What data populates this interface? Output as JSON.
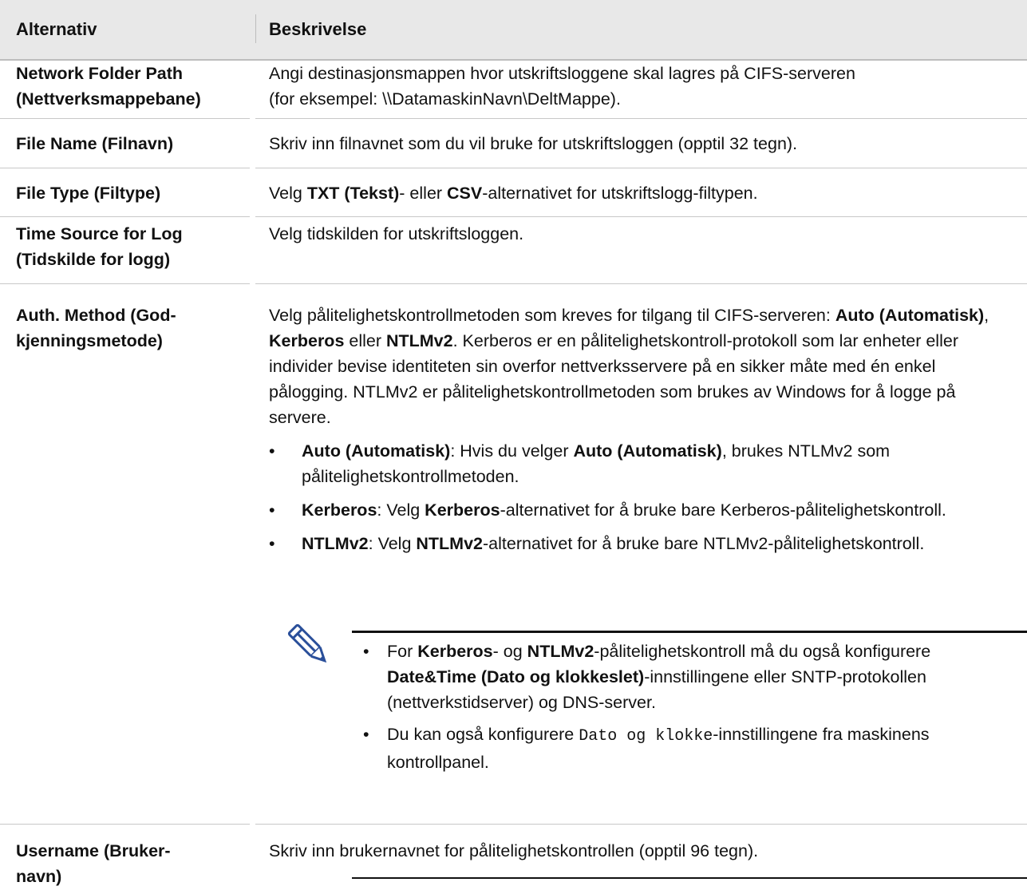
{
  "header": {
    "col1": "Alternativ",
    "col2": "Beskrivelse"
  },
  "rows": [
    {
      "option": [
        "Network Folder Path",
        "(Nettverksmappebane)"
      ],
      "desc": [
        "Angi destinasjonsmappen hvor utskriftsloggene skal lagres på CIFS-serveren",
        "(for eksempel: \\\\DatamaskinNavn\\DeltMappe)."
      ]
    },
    {
      "option": [
        "File Name (Filnavn)"
      ],
      "desc": [
        "Skriv inn filnavnet som du vil bruke for utskriftsloggen (opptil 32 tegn)."
      ]
    },
    {
      "option": [
        "File Type (Filtype)"
      ],
      "desc_parts": [
        "Velg ",
        "TXT (Tekst)",
        "- eller ",
        "CSV",
        "-alternativet for utskriftslogg-filtypen."
      ]
    },
    {
      "option": [
        "Time Source for Log",
        "(Tidskilde for logg)"
      ],
      "desc": [
        "Velg tidskilden for utskriftsloggen."
      ]
    },
    {
      "option": [
        "Auth. Method (God-",
        "kjenningsmetode)"
      ],
      "desc_parts": [
        "Velg pålitelighetskontrollmetoden som kreves for tilgang til CIFS-serveren: ",
        "Auto (Automatisk)",
        ", ",
        "Kerberos",
        " eller ",
        "NTLMv2",
        ". Kerberos er en pålitelighetskontroll-protokoll som lar enheter eller individer bevise identiteten sin overfor nettverksservere på en sikker måte med én enkel pålogging. NTLMv2 er pålitelighetskontrollmetoden som brukes av Windows for å logge på servere."
      ],
      "bullets": [
        [
          "Auto (Automatisk)",
          ": Hvis du velger ",
          "Auto (Automatisk)",
          ", brukes NTLMv2 som pålitelighetskontrollmetoden."
        ],
        [
          "Kerberos",
          ": Velg ",
          "Kerberos",
          "-alternativet for å bruke bare Kerberos-pålitelighetskontroll."
        ],
        [
          "NTLMv2",
          ": Velg ",
          "NTLMv2",
          "-alternativet for å bruke bare NTLMv2-pålitelighetskontroll."
        ]
      ],
      "note": {
        "icon": "pencil-icon",
        "items": [
          [
            "For ",
            "Kerberos",
            "- og ",
            "NTLMv2",
            "-pålitelighetskontroll må du også konfigurere ",
            "Date&Time (Dato og klokkeslet)",
            "-innstillingene eller SNTP-protokollen (nettverkstidserver) og DNS-server."
          ],
          [
            "Du kan også konfigurere ",
            "Dato og klokke",
            "-innstillingene fra maskinens kontrollpanel."
          ]
        ]
      }
    },
    {
      "option": [
        "Username (Bruker-",
        "navn)"
      ],
      "desc": [
        "Skriv inn brukernavnet for pålitelighetskontrollen (opptil 96 tegn)."
      ]
    }
  ],
  "bullet_char": "•"
}
